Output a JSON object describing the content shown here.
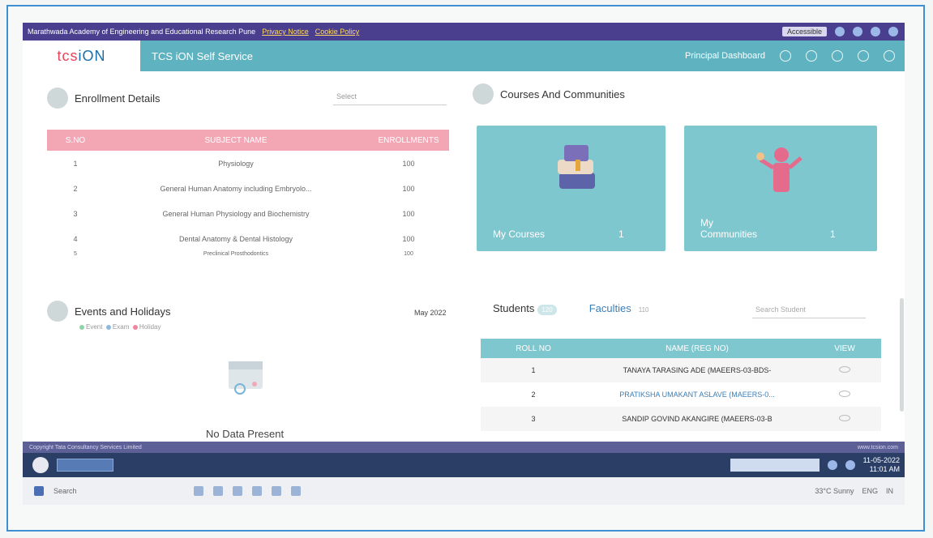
{
  "browser": {
    "title": "Marathwada Academy of Engineering and Educational Research Pune",
    "privacy": "Privacy Notice",
    "cookie": "Cookie Policy",
    "lang": "Accessible"
  },
  "header": {
    "logo_a": "tcs",
    "logo_b": "iON",
    "app_title": "TCS iON Self Service",
    "dashboard": "Principal Dashboard"
  },
  "enrollment": {
    "title": "Enrollment Details",
    "dropdown": "Select",
    "columns": [
      "S.NO",
      "SUBJECT NAME",
      "ENROLLMENTS"
    ],
    "rows": [
      {
        "no": "1",
        "name": "Physiology",
        "count": "100"
      },
      {
        "no": "2",
        "name": "General Human Anatomy including Embryolo...",
        "count": "100"
      },
      {
        "no": "3",
        "name": "General Human Physiology and Biochemistry",
        "count": "100"
      },
      {
        "no": "4",
        "name": "Dental Anatomy & Dental Histology",
        "count": "100"
      },
      {
        "no": "5",
        "name": "Preclinical Prosthodontics",
        "count": "100"
      }
    ]
  },
  "courses": {
    "title": "Courses And Communities",
    "my_courses": "My Courses",
    "my_courses_count": "1",
    "my_communities": "My Communities",
    "my_communities_count": "1"
  },
  "events": {
    "title": "Events and Holidays",
    "legend_event": "Event",
    "legend_exam": "Exam",
    "legend_holiday": "Holiday",
    "month": "May 2022",
    "empty": "No Data Present"
  },
  "people": {
    "tab_students": "Students",
    "students_count": "120",
    "tab_faculties": "Faculties",
    "faculties_count": "110",
    "search_placeholder": "Search Student",
    "columns": [
      "ROLL NO",
      "NAME (REG NO)",
      "VIEW"
    ],
    "rows": [
      {
        "roll": "1",
        "name": "TANAYA TARASING ADE (MAEERS-03-BDS-"
      },
      {
        "roll": "2",
        "name": "PRATIKSHA UMAKANT ASLAVE (MAEERS-0..."
      },
      {
        "roll": "3",
        "name": "SANDIP GOVIND AKANGIRE (MAEERS-03-B"
      }
    ]
  },
  "footer": {
    "left": "Copyright Tata Consultancy Services Limited",
    "right": "www.tcsion.com"
  },
  "taskbar": {
    "search": "Search",
    "weather": "33°C Sunny",
    "lang": "ENG",
    "region": "IN",
    "time": "11:01 AM",
    "date": "11-05-2022"
  },
  "colors": {
    "header": "#5fb3c0",
    "table_pink": "#f3a6b4",
    "tile": "#7fc7cf",
    "browser": "#4a3f8f"
  }
}
